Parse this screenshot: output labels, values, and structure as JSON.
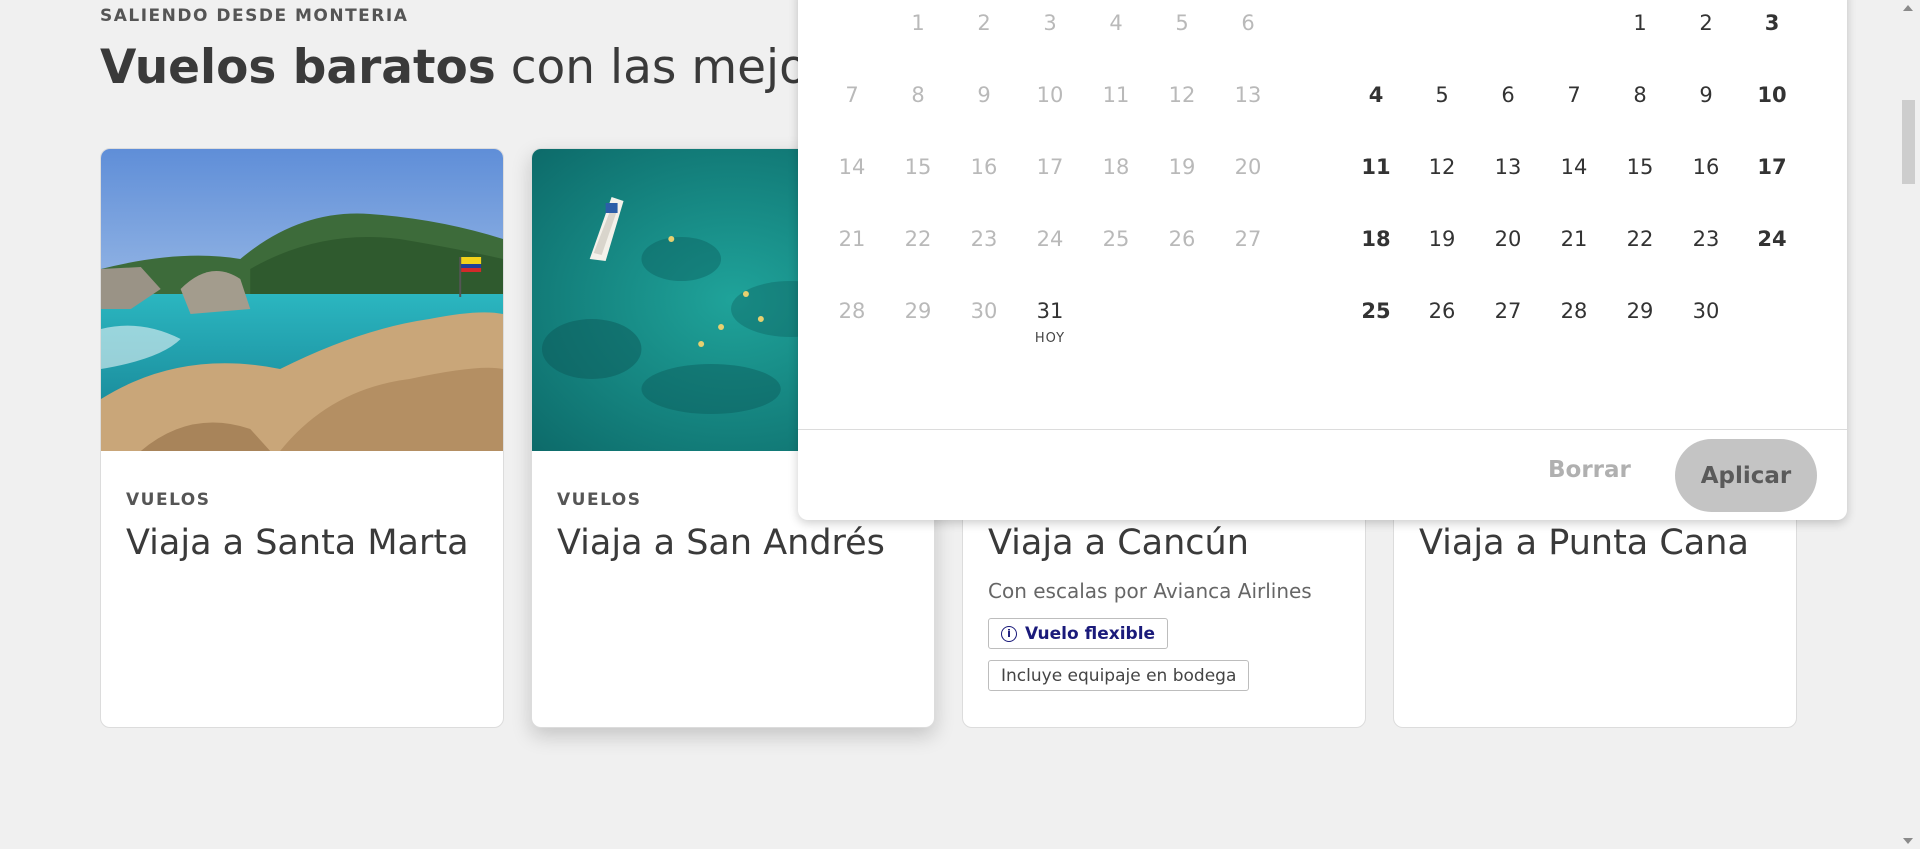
{
  "section": {
    "kicker": "SALIENDO DESDE MONTERIA",
    "title_bold": "Vuelos baratos",
    "title_rest": " con las mejores"
  },
  "cards": [
    {
      "kicker": "VUELOS",
      "title": "Viaja a Santa Marta",
      "image": "santa-marta-beach-photo"
    },
    {
      "kicker": "VUELOS",
      "title": "Viaja a San Andrés",
      "image": "san-andres-aerial-sea-photo"
    },
    {
      "title": "Viaja a Cancún",
      "subtitle": "Con escalas por Avianca Airlines",
      "badge_flex": "Vuelo flexible",
      "badge_luggage": "Incluye equipaje en bodega",
      "flex_icon": "info-icon"
    },
    {
      "title": "Viaja a Punta Cana"
    }
  ],
  "calendar": {
    "left_month": {
      "rows": [
        [
          "",
          "1",
          "2",
          "3",
          "4",
          "5",
          "6"
        ],
        [
          "7",
          "8",
          "9",
          "10",
          "11",
          "12",
          "13"
        ],
        [
          "14",
          "15",
          "16",
          "17",
          "18",
          "19",
          "20"
        ],
        [
          "21",
          "22",
          "23",
          "24",
          "25",
          "26",
          "27"
        ],
        [
          "28",
          "29",
          "30",
          "31",
          "",
          "",
          ""
        ]
      ],
      "today": "31",
      "today_label": "HOY"
    },
    "right_month": {
      "rows": [
        [
          "",
          "",
          "",
          "",
          "1",
          "2",
          "3"
        ],
        [
          "4",
          "5",
          "6",
          "7",
          "8",
          "9",
          "10"
        ],
        [
          "11",
          "12",
          "13",
          "14",
          "15",
          "16",
          "17"
        ],
        [
          "18",
          "19",
          "20",
          "21",
          "22",
          "23",
          "24"
        ],
        [
          "25",
          "26",
          "27",
          "28",
          "29",
          "30",
          ""
        ]
      ]
    },
    "clear_label": "Borrar",
    "apply_label": "Aplicar"
  },
  "colors": {
    "accent_flex": "#1a1a7a",
    "apply_bg": "#c4c4c4",
    "page_bg": "#f0f0f0"
  }
}
